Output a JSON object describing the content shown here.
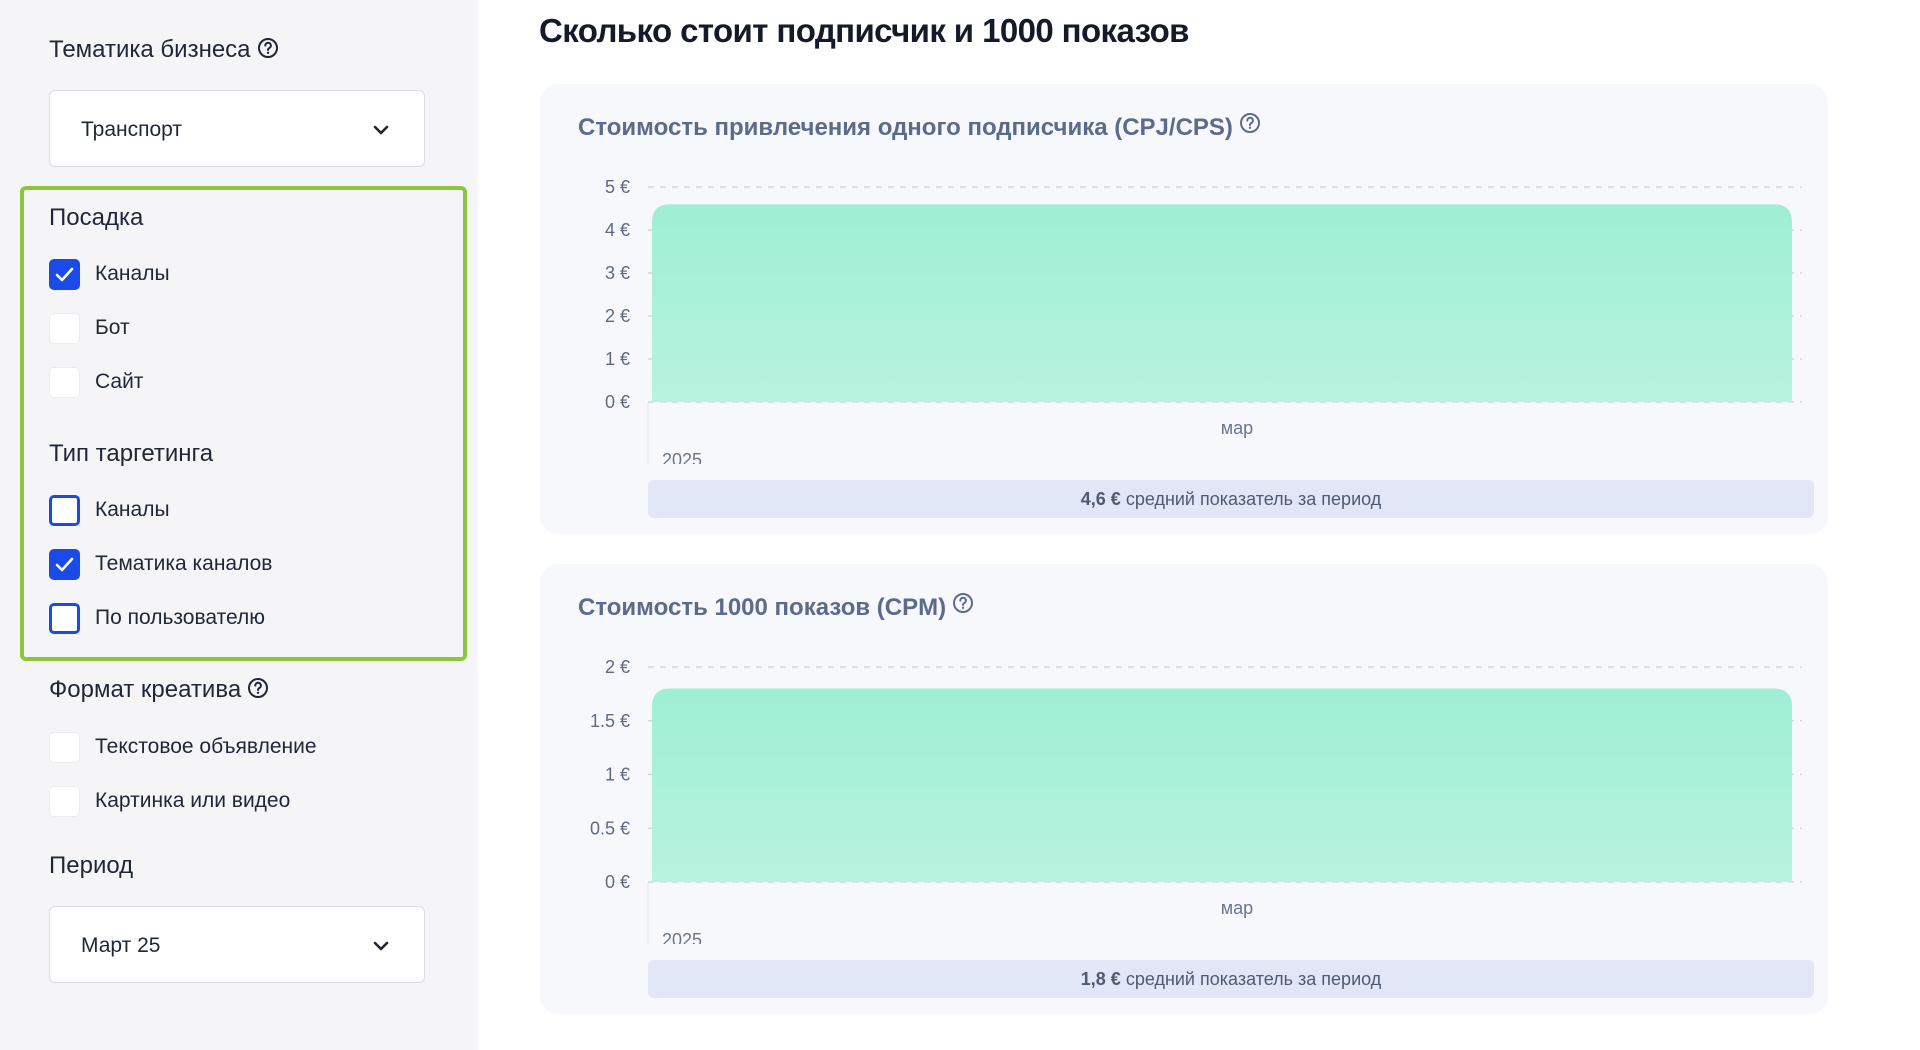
{
  "sidebar": {
    "business_topic": {
      "label": "Тематика бизнеса",
      "value": "Транспорт"
    },
    "landing": {
      "label": "Посадка",
      "options": [
        {
          "label": "Каналы",
          "checked": true
        },
        {
          "label": "Бот",
          "checked": false
        },
        {
          "label": "Сайт",
          "checked": false
        }
      ]
    },
    "targeting": {
      "label": "Тип таргетинга",
      "options": [
        {
          "label": "Каналы",
          "checked": false
        },
        {
          "label": "Тематика каналов",
          "checked": true
        },
        {
          "label": "По пользователю",
          "checked": false
        }
      ]
    },
    "creative_format": {
      "label": "Формат креатива",
      "options": [
        {
          "label": "Текстовое объявление",
          "checked": false
        },
        {
          "label": "Картинка или видео",
          "checked": false
        }
      ]
    },
    "period": {
      "label": "Период",
      "value": "Март 25"
    }
  },
  "main": {
    "title": "Сколько стоит подписчик и 1000 показов",
    "cards": [
      {
        "title": "Стоимость привлечения одного подписчика (CPJ/CPS)",
        "summary_value": "4,6 €",
        "summary_text": "средний показатель за период"
      },
      {
        "title": "Стоимость 1000 показов (CPM)",
        "summary_value": "1,8 €",
        "summary_text": "средний показатель за период"
      }
    ]
  },
  "colors": {
    "accent": "#1a4be6",
    "highlight_border": "#8fc53c",
    "area_fill_top": "#9eefd4",
    "area_fill_bottom": "#b8f3df"
  },
  "chart_data": [
    {
      "type": "area",
      "x": [
        "мар"
      ],
      "x_year": "2025",
      "values": [
        4.6
      ],
      "yticks": [
        "0 €",
        "1 €",
        "2 €",
        "3 €",
        "4 €",
        "5 €"
      ],
      "ylim": [
        0,
        5
      ],
      "grid": true
    },
    {
      "type": "area",
      "x": [
        "мар"
      ],
      "x_year": "2025",
      "values": [
        1.8
      ],
      "yticks": [
        "0 €",
        "0.5 €",
        "1 €",
        "1.5 €",
        "2 €"
      ],
      "ylim": [
        0,
        2
      ],
      "grid": true
    }
  ]
}
